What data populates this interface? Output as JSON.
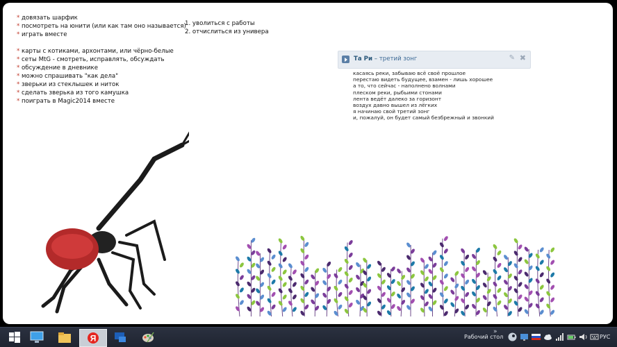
{
  "notes": {
    "list1": [
      "* довязать шарфик",
      "* посмотреть на юнити (или как там оно называется)",
      "* играть вместе",
      "",
      "* карты с котиками, архонтами, или чёрно-белые",
      "* сеты MtG - смотреть, исправлять, обсуждать",
      "* обсуждение в дневнике",
      "* можно спрашивать \"как дела\"",
      "* зверьки из стеклышек  и ниток",
      "* сделать зверька из того камушка",
      "* поиграть в Magic2014 вместе"
    ],
    "list2": [
      "1. уволиться с работы",
      "2. отчислиться из универа"
    ]
  },
  "player": {
    "artist": "Та Ри",
    "separator": " – ",
    "title": "третий зонг",
    "edit_icon": "pencil-icon",
    "close_icon": "close-icon"
  },
  "lyrics": [
    "касаясь реки, забываю всё своё прошлое",
    "перестаю видеть будущее, взамен - лишь хорошее",
    "а то, что сейчас - наполнено волнами",
    "плеском реки, рыбьими стонами",
    "лента ведёт далеко за горизонт",
    "воздух давно вышел из лёгких",
    "я начинаю свой третий зонг",
    "и, пожалуй, он будет самый безбрежный и звонкий"
  ],
  "taskbar": {
    "desktop_label": "Рабочий стол",
    "chevron": "»",
    "language": "РУС",
    "apps": [
      "start-icon",
      "desktop-app-icon",
      "file-explorer-icon",
      "yandex-browser-icon",
      "remote-desktop-icon",
      "paint-icon"
    ],
    "tray": [
      "steam-icon",
      "monitor-icon",
      "flag-ru-icon",
      "cloud-icon",
      "network-icon",
      "battery-icon",
      "volume-icon",
      "keyboard-icon"
    ]
  },
  "colors": {
    "star": "#c0392b",
    "player_bg": "#e7ecf2",
    "link": "#2b587a",
    "taskbar": "#252a36"
  }
}
